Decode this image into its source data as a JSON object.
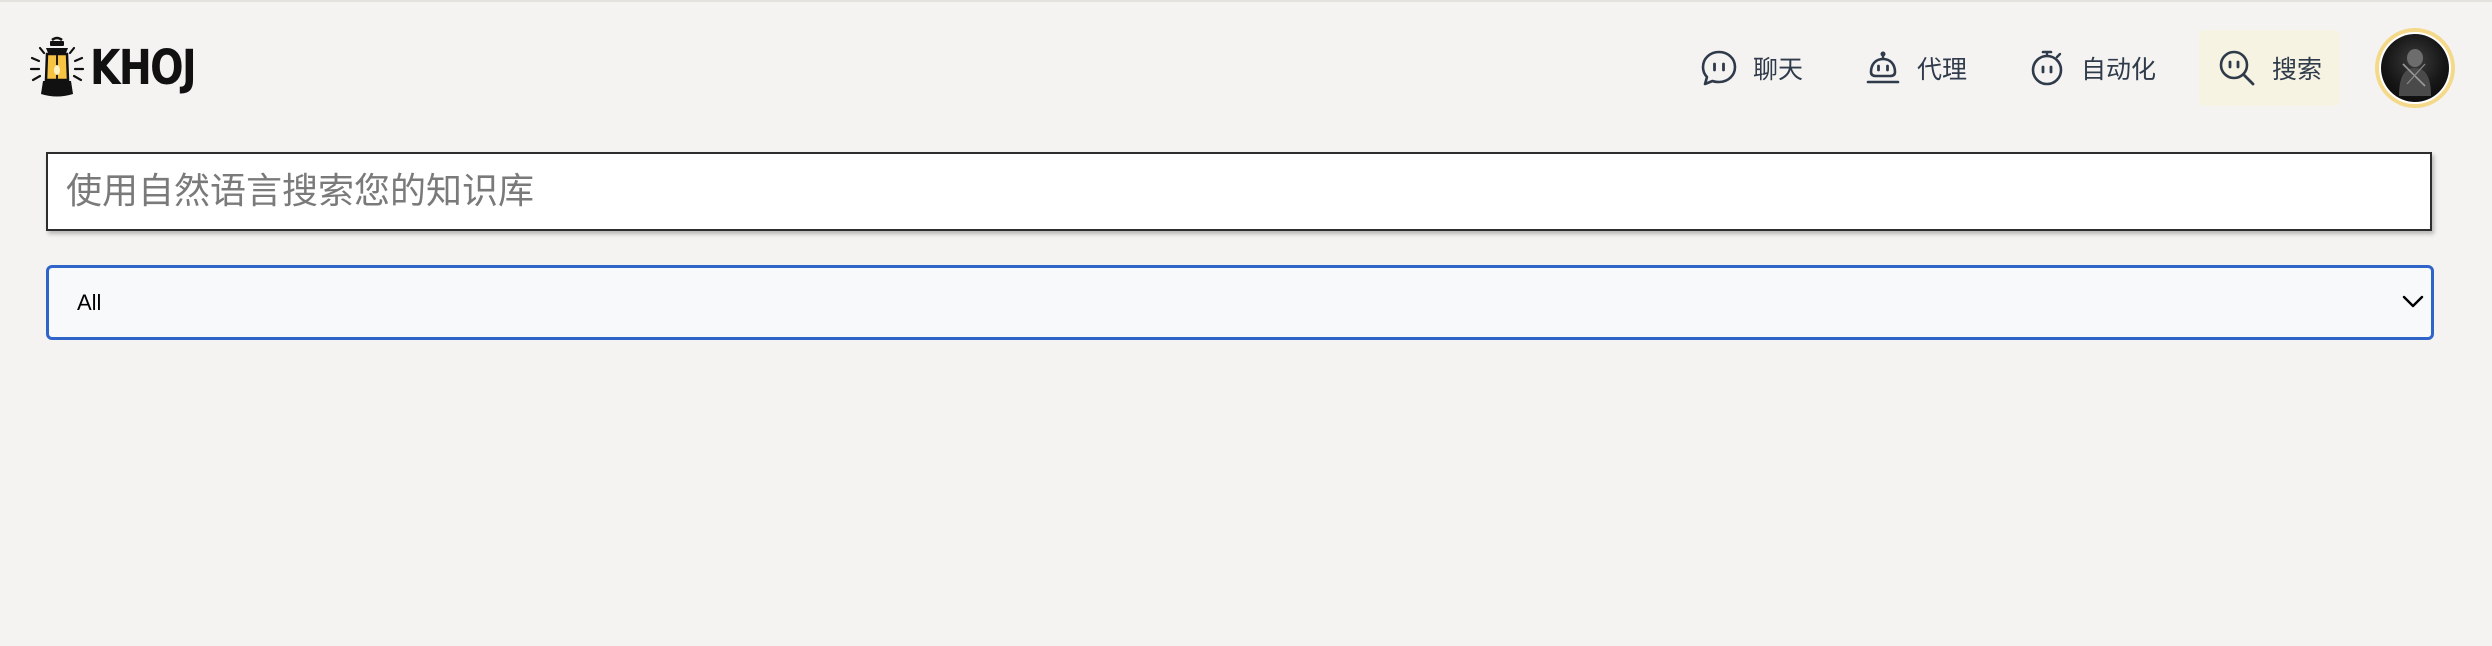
{
  "app": {
    "logo_text": "KHOJ",
    "brand_color": "#f6c343"
  },
  "nav": {
    "items": [
      {
        "label": "聊天",
        "icon": "chat-bubble-icon"
      },
      {
        "label": "代理",
        "icon": "robot-icon"
      },
      {
        "label": "自动化",
        "icon": "stopwatch-icon"
      },
      {
        "label": "搜索",
        "icon": "search-face-icon",
        "active": true
      }
    ],
    "active_bg": "#f6f3e2"
  },
  "user": {
    "avatar": "user-avatar"
  },
  "search": {
    "placeholder": "使用自然语言搜索您的知识库",
    "value": ""
  },
  "filter": {
    "selected": "All",
    "border_color": "#2f64c9"
  }
}
